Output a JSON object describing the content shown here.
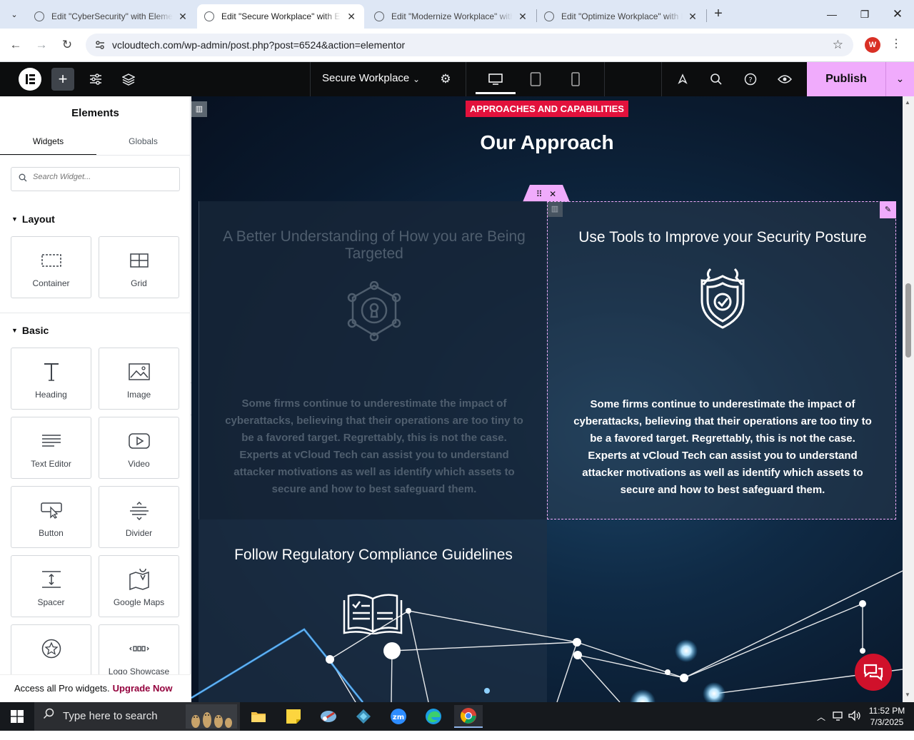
{
  "browser": {
    "tabs": [
      {
        "title": "Edit \"CyberSecurity\" with Elementor",
        "active": false
      },
      {
        "title": "Edit \"Secure Workplace\" with Elementor",
        "active": true
      },
      {
        "title": "Edit \"Modernize Workplace\" with Elementor",
        "active": false
      },
      {
        "title": "Edit \"Optimize Workplace\" with Elementor",
        "active": false
      }
    ],
    "url": "vcloudtech.com/wp-admin/post.php?post=6524&action=elementor",
    "profile_initial": "W"
  },
  "topbar": {
    "document_title": "Secure Workplace",
    "publish_label": "Publish"
  },
  "panel": {
    "title": "Elements",
    "tabs": [
      "Widgets",
      "Globals"
    ],
    "search_placeholder": "Search Widget...",
    "sections": {
      "layout": {
        "title": "Layout",
        "widgets": [
          {
            "label": "Container",
            "icon": "container-icon"
          },
          {
            "label": "Grid",
            "icon": "grid-icon"
          }
        ]
      },
      "basic": {
        "title": "Basic",
        "widgets": [
          {
            "label": "Heading",
            "icon": "heading-icon"
          },
          {
            "label": "Image",
            "icon": "image-icon"
          },
          {
            "label": "Text Editor",
            "icon": "text-editor-icon"
          },
          {
            "label": "Video",
            "icon": "video-icon"
          },
          {
            "label": "Button",
            "icon": "button-icon"
          },
          {
            "label": "Divider",
            "icon": "divider-icon"
          },
          {
            "label": "Spacer",
            "icon": "spacer-icon"
          },
          {
            "label": "Google Maps",
            "icon": "google-maps-icon"
          },
          {
            "label": "",
            "icon": "star-icon"
          },
          {
            "label": "Logo Showcase",
            "icon": "logo-showcase-icon"
          }
        ]
      }
    },
    "pro_bar": {
      "text": "Access all Pro widgets.",
      "link": "Upgrade Now"
    }
  },
  "canvas": {
    "badge": "APPROACHES AND CAPABILITIES",
    "heading": "Our Approach",
    "cards": [
      {
        "title": "A Better Understanding of How you are Being Targeted",
        "text": "Some firms continue to underestimate the impact of cyberattacks, believing that their operations are too tiny to be a favored target. Regrettably, this is not the case. Experts at vCloud Tech can assist you to understand attacker motivations as well as identify which assets to secure and how to best safeguard them."
      },
      {
        "title": "Use Tools to Improve your Security Posture",
        "text": "Some firms continue to underestimate the impact of cyberattacks, believing that their operations are too tiny to be a favored target. Regrettably, this is not the case. Experts at vCloud Tech can assist you to understand attacker motivations as well as identify which assets to secure and how to best safeguard them."
      },
      {
        "title": "Follow Regulatory Compliance Guidelines"
      }
    ]
  },
  "taskbar": {
    "search_placeholder": "Type here to search",
    "time": "11:52 PM",
    "date": "7/3/2025"
  },
  "colors": {
    "accent": "#f0abfc",
    "badge": "#e2113c",
    "topbar": "#0c0d0e",
    "pro_link": "#93003c"
  }
}
